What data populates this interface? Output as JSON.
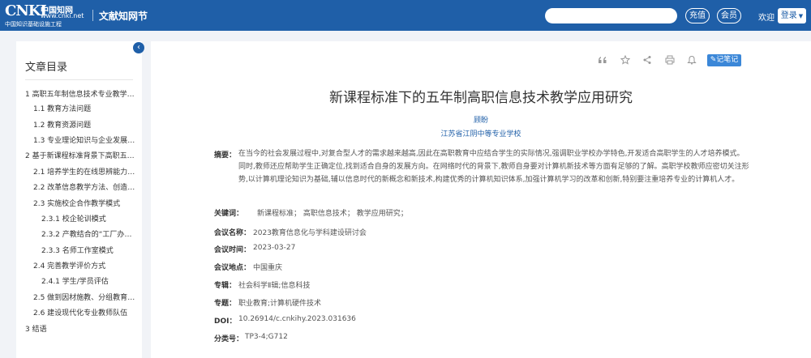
{
  "header": {
    "logo_text": "CNKI",
    "logo_cn": "中国知网",
    "logo_url": "www.cnki.net",
    "logo_sub": "中国知识基础设施工程",
    "section": "文献知网节",
    "search_placeholder": "",
    "recharge": "充值",
    "member": "会员",
    "welcome": "欢迎",
    "login": "登录"
  },
  "sidebar": {
    "title": "文章目录",
    "items": [
      {
        "label": "1 高职五年制信息技术专业教学中..."
      },
      {
        "label": "1.1 教育方法问题"
      },
      {
        "label": "1.2 教育资源问题"
      },
      {
        "label": "1.3 专业理论知识与企业发展需..."
      },
      {
        "label": "2 基于新课程标准背景下高职五年..."
      },
      {
        "label": "2.1 培养学生的在线思辨能力和..."
      },
      {
        "label": "2.2 改革信息教学方法、创造良..."
      },
      {
        "label": "2.3 实施校企合作教学模式"
      },
      {
        "label": "2.3.1 校企轮训模式"
      },
      {
        "label": "2.3.2 产教结合的“工厂办学”..."
      },
      {
        "label": "2.3.3 名师工作室模式"
      },
      {
        "label": "2.4 完善教学评价方式"
      },
      {
        "label": "2.4.1 学生/学员评估"
      },
      {
        "label": "2.5 做到因材施教、分组教育是..."
      },
      {
        "label": "2.6 建设现代化专业教师队伍"
      },
      {
        "label": "3 结语"
      }
    ]
  },
  "toolbar": {
    "note_label": "记笔记",
    "icons": [
      "quote-icon",
      "star-icon",
      "share-icon",
      "print-icon",
      "bell-icon"
    ]
  },
  "article": {
    "title": "新课程标准下的五年制高职信息技术教学应用研究",
    "author": "顾盼",
    "affiliation": "江苏省江阴中等专业学校",
    "abstract_label": "摘要：",
    "abstract": "在当今的社会发展过程中,对复合型人才的需求越来越高,因此在高职教育中应结合学生的实际情况,强调职业学校办学特色,开发适合高职学生的人才培养模式。同时,教师还应帮助学生正确定位,找到适合自身的发展方向。在网络时代的背景下,教师自身要对计算机新技术等方面有足够的了解。高职学校教师应密切关注形势,以计算机理论知识为基础,辅以信息时代的新概念和新技术,构建优秀的计算机知识体系,加强计算机学习的改革和创新,特别要注重培养专业的计算机人才。",
    "fields": [
      {
        "label": "关键词：",
        "value": "新课程标准；  高职信息技术；  教学应用研究；"
      },
      {
        "label": "会议名称：",
        "value": "2023教育信息化与学科建设研讨会"
      },
      {
        "label": "会议时间：",
        "value": "2023-03-27"
      },
      {
        "label": "会议地点：",
        "value": "中国重庆"
      },
      {
        "label": "专辑：",
        "value": "社会科学Ⅱ辑;信息科技"
      },
      {
        "label": "专题：",
        "value": "职业教育;计算机硬件技术"
      },
      {
        "label": "DOI：",
        "value": "10.26914/c.cnkihy.2023.031636"
      },
      {
        "label": "分类号：",
        "value": "TP3-4;G712"
      }
    ]
  },
  "colors": {
    "brand": "#1f5fa8",
    "accent_button": "#3b87d8",
    "link": "#1f5fa8"
  }
}
